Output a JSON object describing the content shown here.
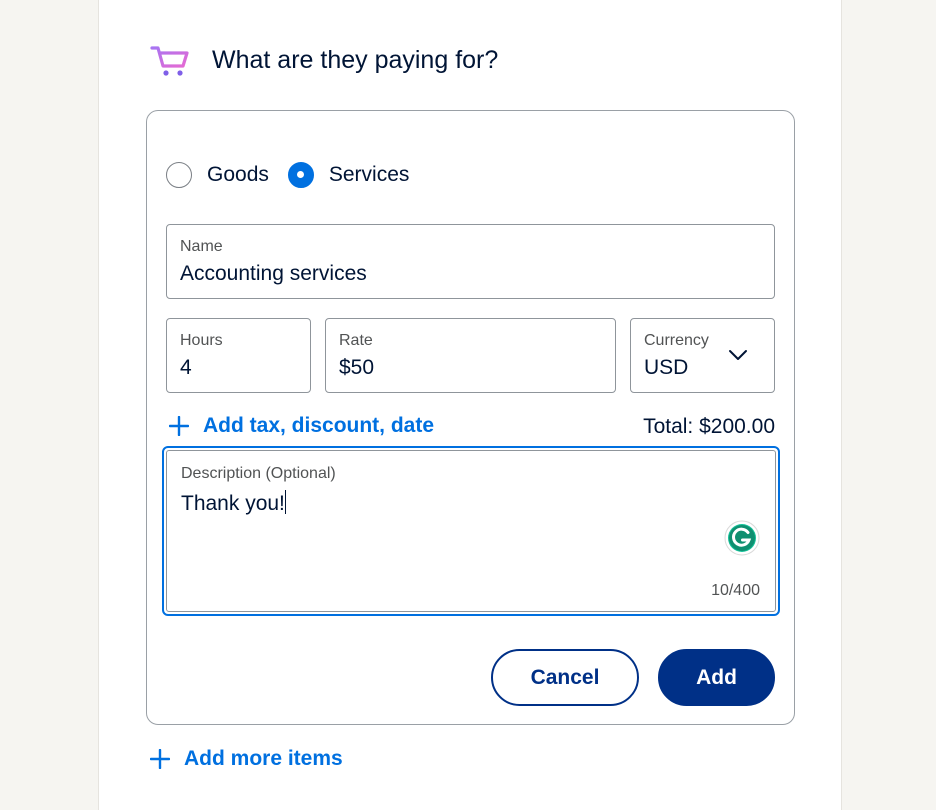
{
  "section": {
    "title": "What are they paying for?",
    "icon": "shopping-cart-icon"
  },
  "item_type": {
    "options": [
      {
        "label": "Goods",
        "checked": false
      },
      {
        "label": "Services",
        "checked": true
      }
    ]
  },
  "fields": {
    "name": {
      "label": "Name",
      "value": "Accounting services"
    },
    "hours": {
      "label": "Hours",
      "value": "4"
    },
    "rate": {
      "label": "Rate",
      "value": "$50"
    },
    "currency": {
      "label": "Currency",
      "value": "USD"
    }
  },
  "add_tax_link": "Add tax, discount, date",
  "total": "Total: $200.00",
  "description": {
    "label": "Description (Optional)",
    "value": "Thank you!",
    "counter": "10/400"
  },
  "buttons": {
    "cancel": "Cancel",
    "add": "Add"
  },
  "add_more_link": "Add more items",
  "colors": {
    "accent": "#0070e0",
    "primary_dark": "#003087",
    "text": "#001435",
    "page_bg": "#f6f5f1"
  }
}
